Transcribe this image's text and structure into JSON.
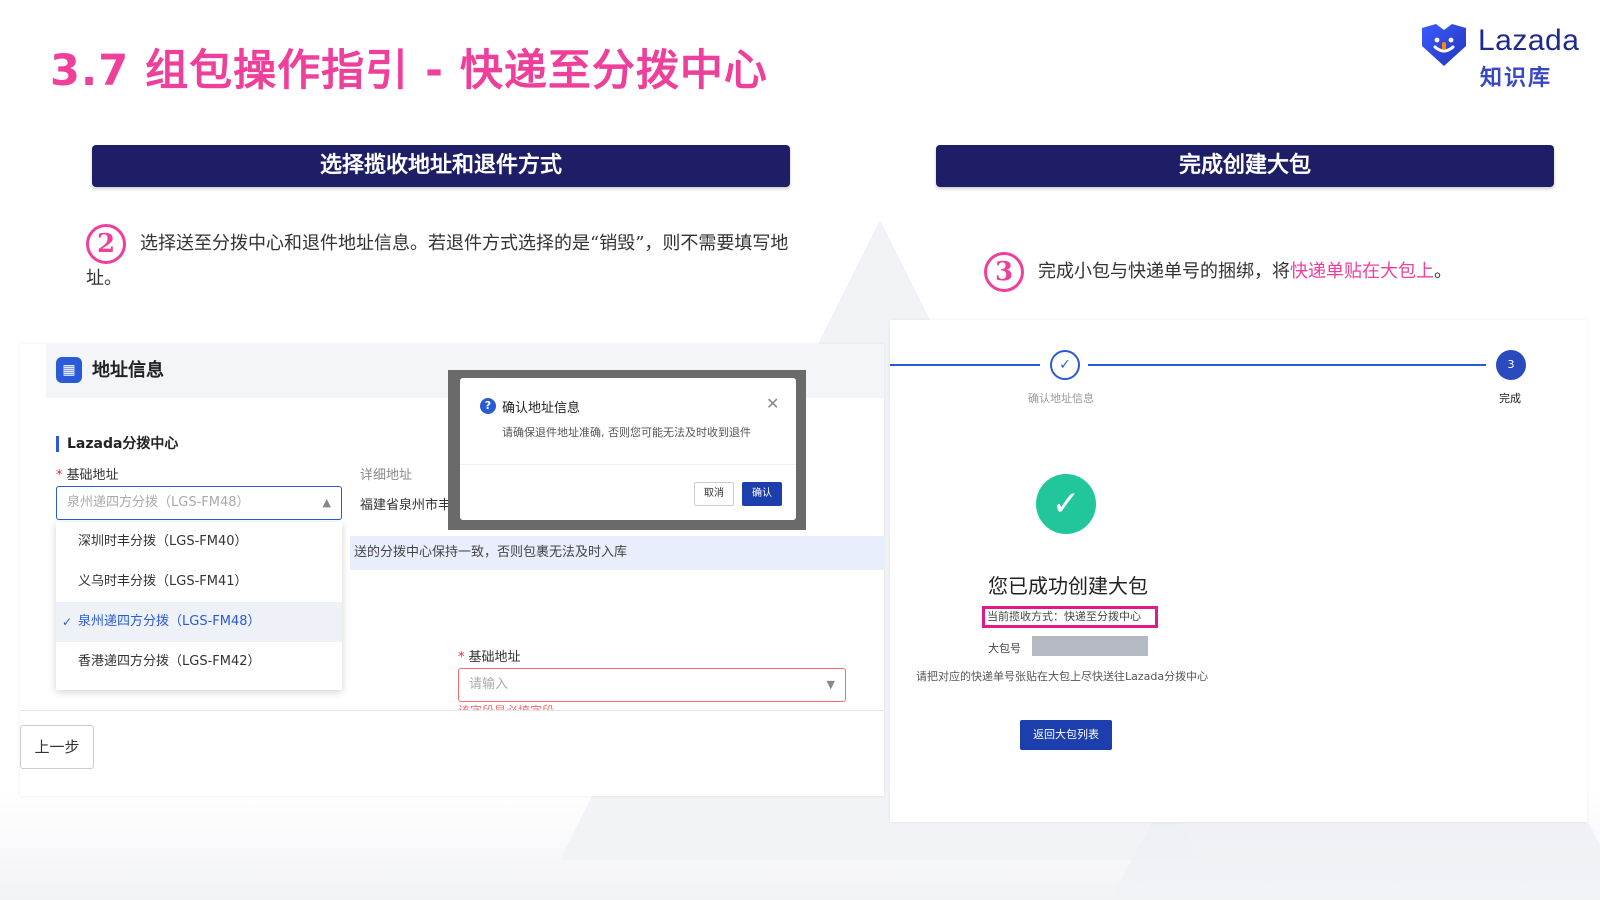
{
  "page": {
    "title": "3.7 组包操作指引 - 快递至分拨中心",
    "accent_color": "#ee3f9b",
    "header_color": "#1d1e66"
  },
  "logo": {
    "name": "Lazada",
    "sub": "知识库",
    "icon": "lazada-heart-smile-icon"
  },
  "sections": {
    "left_header": "选择揽收地址和退件方式",
    "right_header": "完成创建大包"
  },
  "step2": {
    "number": "2",
    "text": "选择送至分拨中心和退件地址信息。若退件方式选择的是“销毁”，则不需要填写地址。"
  },
  "step3": {
    "number": "3",
    "text_before": "完成小包与快递单号的捆绑，将",
    "text_highlight": "快递单贴在大包上",
    "text_after": "。"
  },
  "left_ui": {
    "panel_icon": "grid-icon",
    "panel_title": "地址信息",
    "subtitle": "Lazada分拨中心",
    "basic_address_label": "基础地址",
    "basic_address_value": "泉州递四方分拨（LGS-FM48）",
    "detail_address_label": "详细地址",
    "detail_address_value": "福建省泉州市丰",
    "info_text": "送的分拨中心保持一致，否则包裹无法及时入库",
    "dropdown_options": [
      {
        "label": "深圳时丰分拨（LGS-FM40）",
        "selected": false
      },
      {
        "label": "义乌时丰分拨（LGS-FM41）",
        "selected": false
      },
      {
        "label": "泉州递四方分拨（LGS-FM48）",
        "selected": true
      },
      {
        "label": "香港递四方分拨（LGS-FM42）",
        "selected": false
      }
    ],
    "return_address_label": "基础地址",
    "return_address_placeholder": "请输入",
    "error_text": "该字段是必填字段",
    "prev_button": "上一步"
  },
  "dialog": {
    "title": "确认地址信息",
    "message": "请确保退件地址准确, 否则您可能无法及时收到退件",
    "cancel": "取消",
    "confirm": "确认",
    "close_icon": "close-icon",
    "question_icon": "question-icon"
  },
  "right_ui": {
    "step1_label": "确认地址信息",
    "step3_number": "3",
    "step3_label": "完成",
    "success_text": "您已成功创建大包",
    "method_text": "当前揽收方式：快递至分拨中心",
    "bag_label": "大包号",
    "hint_text": "请把对应的快递单号张贴在大包上尽快送往Lazada分拨中心",
    "back_button": "返回大包列表"
  }
}
